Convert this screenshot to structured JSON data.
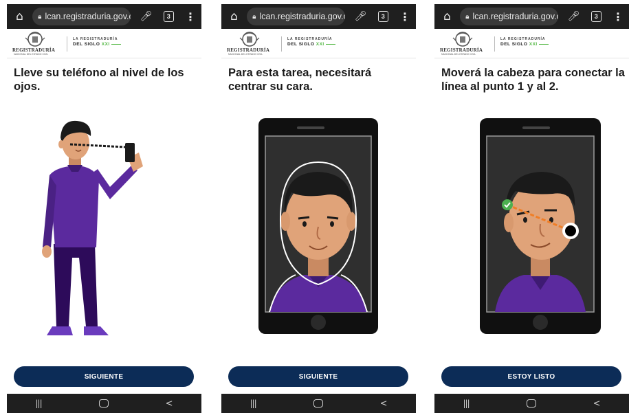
{
  "browser": {
    "url": "lcan.registraduria.gov.co",
    "tab_count": "3"
  },
  "header": {
    "logo_text": "REGISTRADURÍA",
    "logo_subtext": "NACIONAL DEL ESTADO CIVIL",
    "slogan_line1": "LA REGISTRADURÍA",
    "slogan_line2": "DEL SIGLO",
    "slogan_highlight": "XXI"
  },
  "screens": [
    {
      "instruction": "Lleve su teléfono al nivel de los\nojos.",
      "button_label": "SIGUIENTE"
    },
    {
      "instruction": "Para esta tarea, necesitará\ncentrar su cara.",
      "button_label": "SIGUIENTE"
    },
    {
      "instruction": "Moverá la cabeza para conectar la\nlínea al punto 1 y al 2.",
      "button_label": "ESTOY LISTO"
    }
  ],
  "colors": {
    "button_bg": "#0c2c57",
    "shirt": "#5b2a9e",
    "skin": "#e0a379",
    "hair": "#1a1a1a",
    "guide_line": "#f07e26",
    "check": "#4caf50"
  },
  "icons": [
    "home-icon",
    "lock-icon",
    "mic-icon",
    "tabs-icon",
    "menu-icon",
    "recent-apps-icon",
    "home-nav-icon",
    "back-icon",
    "check-icon",
    "target-dot-icon"
  ]
}
